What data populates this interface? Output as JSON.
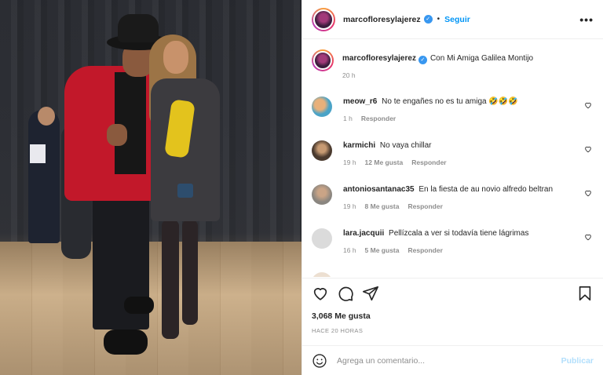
{
  "post": {
    "username": "marcofloresylajerez",
    "verified": true,
    "separator": "•",
    "follow_label": "Seguir",
    "more_label": "•••"
  },
  "caption": {
    "username": "marcofloresylajerez",
    "text": "Con Mi Amiga Galilea Montijo",
    "time": "20 h"
  },
  "comments": [
    {
      "username": "meow_r6",
      "text": "No te engañes no es tu amiga 🤣🤣🤣",
      "time": "1 h",
      "likes": "",
      "reply": "Responder",
      "avatar_color": "#4aa3c7"
    },
    {
      "username": "karmichi",
      "text": "No vaya chillar",
      "time": "19 h",
      "likes": "12 Me gusta",
      "reply": "Responder",
      "avatar_color": "#5c4a3a"
    },
    {
      "username": "antoniosantanac35",
      "text": "En la fiesta de au novio alfredo beltran",
      "time": "19 h",
      "likes": "8 Me gusta",
      "reply": "Responder",
      "avatar_color": "#7a7670"
    },
    {
      "username": "lara.jacquii",
      "text": "Pellízcala a ver si todavía tiene lágrimas",
      "time": "16 h",
      "likes": "5 Me gusta",
      "reply": "Responder",
      "avatar_color": "#dbdbdb"
    }
  ],
  "likes_count": "3,068 Me gusta",
  "posted_ago": "HACE 20 HORAS",
  "comment_box": {
    "placeholder": "Agrega un comentario...",
    "publish_label": "Publicar"
  },
  "icons": {
    "like": "heart-icon",
    "comment": "comment-icon",
    "share": "share-icon",
    "save": "bookmark-icon",
    "emoji": "emoji-icon"
  },
  "colors": {
    "accent": "#0095f6",
    "verified": "#3897f0",
    "muted": "#8e8e8e",
    "publish_disabled": "#b2dffc"
  }
}
